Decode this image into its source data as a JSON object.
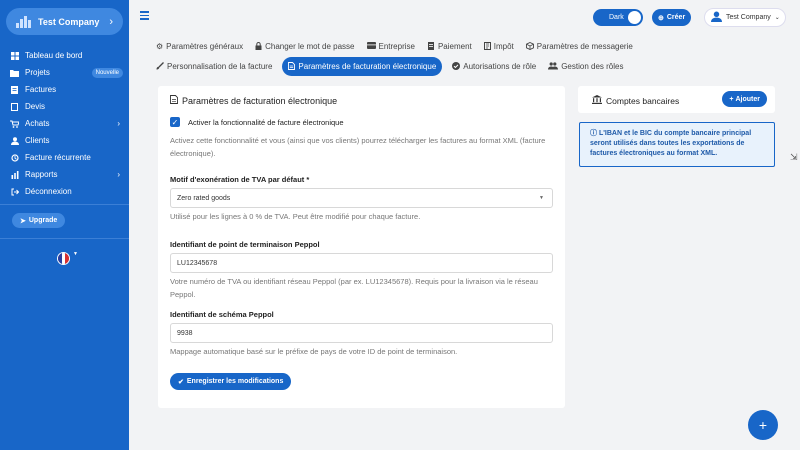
{
  "brand": {
    "name": "Test Company"
  },
  "sidebar": {
    "items": [
      {
        "label": "Tableau de bord",
        "badge": "",
        "arrow": ""
      },
      {
        "label": "Projets",
        "badge": "Nouvelle",
        "arrow": ""
      },
      {
        "label": "Factures",
        "badge": "",
        "arrow": ""
      },
      {
        "label": "Devis",
        "badge": "",
        "arrow": ""
      },
      {
        "label": "Achats",
        "badge": "",
        "arrow": "›"
      },
      {
        "label": "Clients",
        "badge": "",
        "arrow": ""
      },
      {
        "label": "Facture récurrente",
        "badge": "",
        "arrow": ""
      },
      {
        "label": "Rapports",
        "badge": "",
        "arrow": "›"
      },
      {
        "label": "Déconnexion",
        "badge": "",
        "arrow": ""
      }
    ],
    "upgrade_label": "Upgrade"
  },
  "topbar": {
    "theme_label": "Dark",
    "create_label": "Créer",
    "user_label": "Test Company"
  },
  "tabs": [
    {
      "label": "Paramètres généraux",
      "active": false
    },
    {
      "label": "Changer le mot de passe",
      "active": false
    },
    {
      "label": "Entreprise",
      "active": false
    },
    {
      "label": "Paiement",
      "active": false
    },
    {
      "label": "Impôt",
      "active": false
    },
    {
      "label": "Paramètres de messagerie",
      "active": false
    },
    {
      "label": "Personnalisation de la facture",
      "active": false
    },
    {
      "label": "Paramètres de facturation électronique",
      "active": true
    },
    {
      "label": "Autorisations de rôle",
      "active": false
    },
    {
      "label": "Gestion des rôles",
      "active": false
    }
  ],
  "form": {
    "title": "Paramètres de facturation électronique",
    "enable_label": "Activer la fonctionnalité de facture électronique",
    "enable_help": "Activez cette fonctionnalité et vous (ainsi que vos clients) pourrez télécharger les factures au format XML (facture électronique).",
    "vat_label": "Motif d'exonération de TVA par défaut *",
    "vat_value": "Zero rated goods",
    "vat_help": "Utilisé pour les lignes à 0 % de TVA. Peut être modifié pour chaque facture.",
    "peppol_id_label": "Identifiant de point de terminaison Peppol",
    "peppol_id_value": "LU12345678",
    "peppol_id_help": "Votre numéro de TVA ou identifiant réseau Peppol (par ex. LU12345678). Requis pour la livraison via le réseau Peppol.",
    "scheme_label": "Identifiant de schéma Peppol",
    "scheme_value": "9938",
    "scheme_help": "Mappage automatique basé sur le préfixe de pays de votre ID de point de terminaison.",
    "save_label": "Enregistrer les modifications"
  },
  "bank": {
    "title": "Comptes bancaires",
    "add_label": "Ajouter",
    "info": "L'IBAN et le BIC du compte bancaire principal seront utilisés dans toutes les exportations de factures électroniques au format XML."
  },
  "colors": {
    "primary": "#1866c8",
    "sidebar": "#1866c8",
    "info_bg": "#e8f2fc"
  }
}
